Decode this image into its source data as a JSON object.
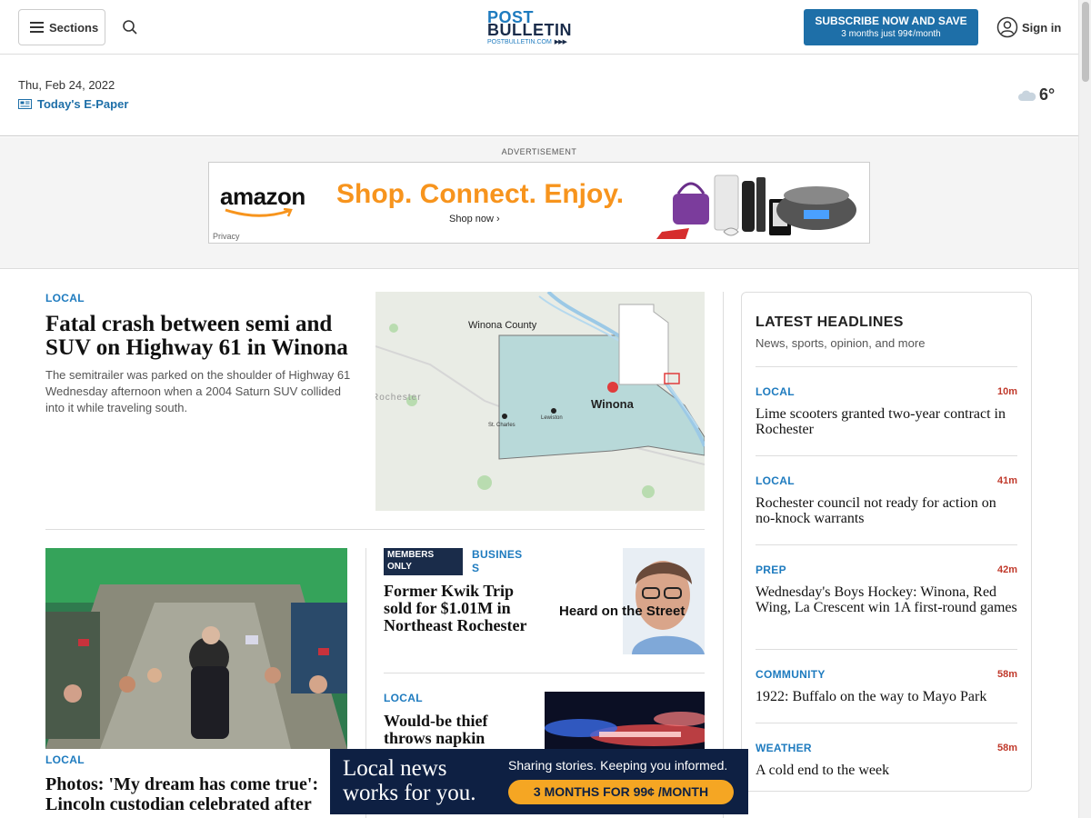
{
  "header": {
    "sections_label": "Sections",
    "logo_line1": "POST",
    "logo_line2": "BULLETIN",
    "logo_line3": "POSTBULLETIN.COM",
    "subscribe_title": "SUBSCRIBE NOW AND SAVE",
    "subscribe_subtitle": "3 months just 99¢/month",
    "signin_label": "Sign in"
  },
  "datebar": {
    "date": "Thu, Feb 24, 2022",
    "epaper_label": "Today's E-Paper",
    "temperature": "6°"
  },
  "ad": {
    "label": "ADVERTISEMENT",
    "brand": "amazon",
    "tagline": "Shop. Connect. Enjoy.",
    "cta": "Shop now ›",
    "privacy": "Privacy"
  },
  "lead": {
    "kicker": "LOCAL",
    "headline": "Fatal crash between semi and SUV on Highway 61 in Winona",
    "summary": "The semitrailer was parked on the shoulder of Highway 61 Wednesday afternoon when a 2004 Saturn SUV collided into it while traveling south.",
    "map": {
      "county_label": "Winona County",
      "city_label": "Winona",
      "rochester_label": "Rochester",
      "stcharles_label": "St. Charles",
      "lewiston_label": "Lewiston"
    }
  },
  "story2": {
    "kicker": "LOCAL",
    "headline": "Photos: 'My dream has come true': Lincoln custodian celebrated after"
  },
  "story3": {
    "badge": "MEMBERS ONLY",
    "kicker": "BUSINESS",
    "headline": "Former Kwik Trip sold for $1.01M in Northeast Rochester",
    "image_text": "Heard on the Street"
  },
  "story4": {
    "kicker": "LOCAL",
    "headline": "Would-be thief throws napkin"
  },
  "latest": {
    "title": "LATEST HEADLINES",
    "subtitle": "News, sports, opinion, and more",
    "items": [
      {
        "kicker": "LOCAL",
        "time": "10m",
        "headline": "Lime scooters granted two-year contract in Rochester"
      },
      {
        "kicker": "LOCAL",
        "time": "41m",
        "headline": "Rochester council not ready for action on no-knock warrants"
      },
      {
        "kicker": "PREP",
        "time": "42m",
        "headline": "Wednesday's Boys Hockey: Winona, Red Wing, La Crescent win 1A first-round games"
      },
      {
        "kicker": "COMMUNITY",
        "time": "58m",
        "headline": "1922: Buffalo on the way to Mayo Park"
      },
      {
        "kicker": "WEATHER",
        "time": "58m",
        "headline": "A cold end to the week"
      }
    ]
  },
  "bottom_ad": {
    "line1": "Local news works for you.",
    "line2": "Sharing stories. Keeping you informed.",
    "cta": "3 MONTHS FOR 99¢ /MONTH"
  },
  "colors": {
    "brand_blue": "#1e7bbf",
    "subscribe_blue": "#1e6fa8",
    "navy": "#1a2c4a",
    "time_red": "#c0392b",
    "cta_orange": "#f5a623"
  }
}
